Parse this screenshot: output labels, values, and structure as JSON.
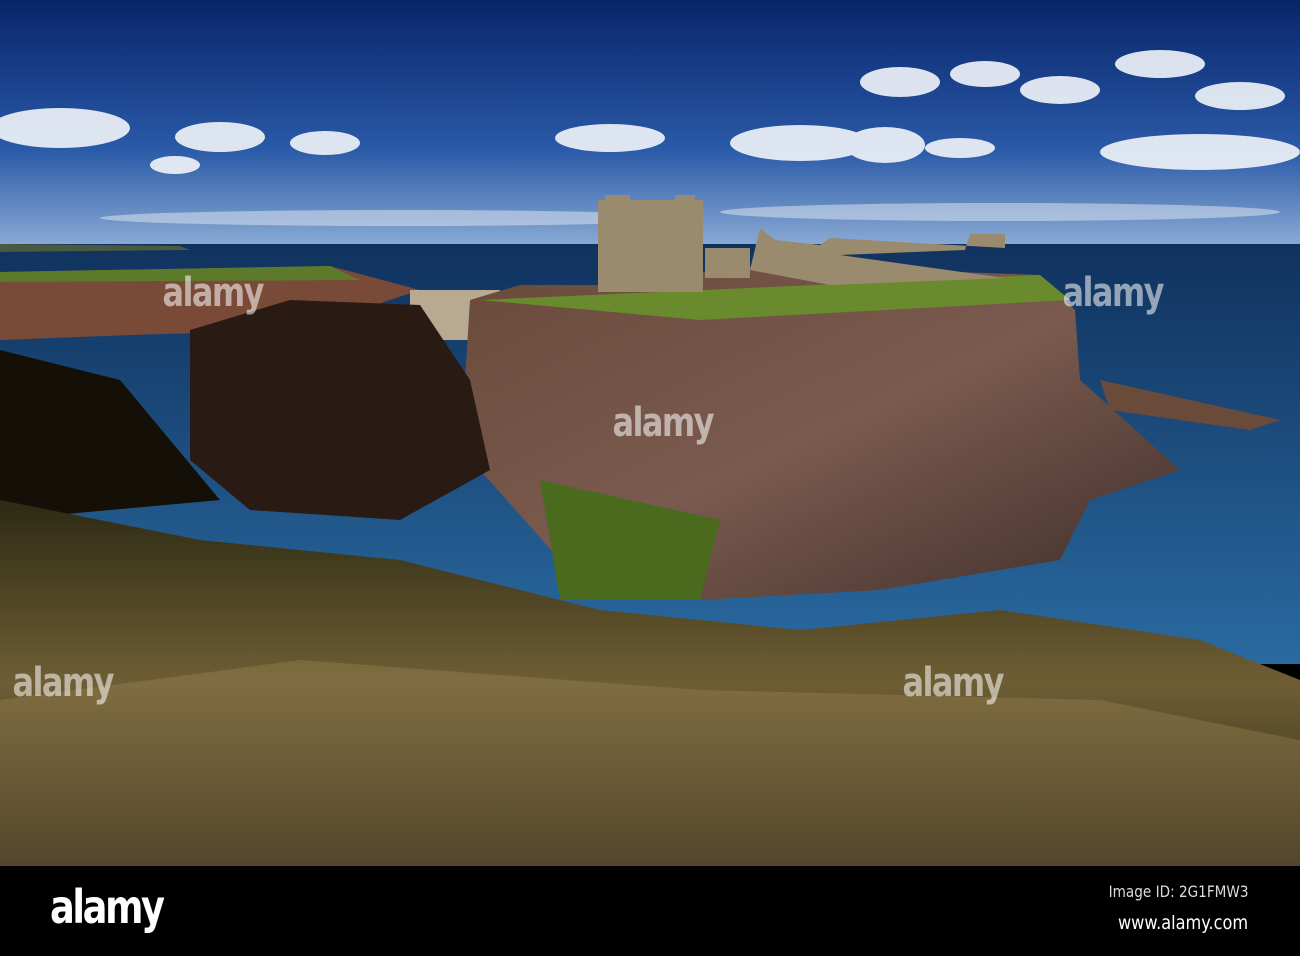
{
  "watermark": {
    "text": "alamy"
  },
  "footer": {
    "logo": "alamy",
    "image_id": "Image ID: 2G1FMW3",
    "url": "www.alamy.com"
  },
  "colors": {
    "sky_top": "#0b2a72",
    "sky_horizon": "#6f93c4",
    "sea": "#1b4d86",
    "grass": "#7a6a3c"
  }
}
